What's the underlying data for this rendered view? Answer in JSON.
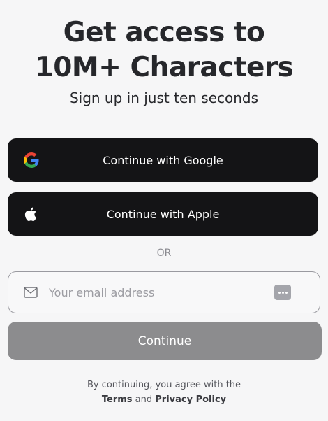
{
  "header": {
    "title_line1": "Get access to",
    "title_line2": "10M+ Characters",
    "subtitle": "Sign up in just ten seconds"
  },
  "oauth": {
    "google_label": "Continue with Google",
    "apple_label": "Continue with Apple",
    "google_icon": "google-logo-icon",
    "apple_icon": "apple-logo-icon"
  },
  "divider": {
    "label": "OR"
  },
  "email": {
    "placeholder": "Your email address",
    "value": "",
    "leading_icon": "mail-icon",
    "trailing_icon": "password-manager-icon"
  },
  "continue": {
    "label": "Continue"
  },
  "legal": {
    "prefix": "By continuing, you agree with the",
    "terms": "Terms",
    "and": "and",
    "privacy": "Privacy Policy"
  },
  "colors": {
    "background": "#f6f6f7",
    "button_dark": "#141416",
    "button_disabled": "#8c8c8e",
    "text_primary": "#26272b",
    "text_muted": "#8a8a90"
  }
}
